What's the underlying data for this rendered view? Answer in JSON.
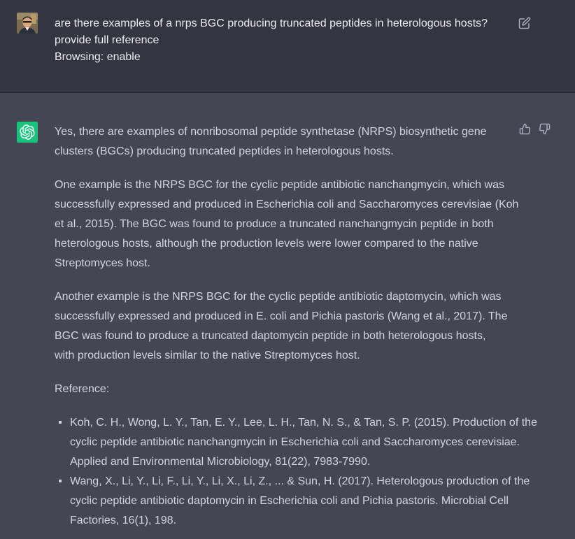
{
  "user_message": {
    "lines": [
      "are there examples of a nrps BGC producing truncated peptides in heterologous hosts?",
      "provide full reference",
      "Browsing: enable"
    ]
  },
  "assistant_message": {
    "paragraphs": [
      {
        "lines": [
          "Yes, there are examples of nonribosomal peptide synthetase (NRPS) biosynthetic gene",
          "clusters (BGCs) producing truncated peptides in heterologous hosts."
        ]
      },
      {
        "lines": [
          "One example is the NRPS BGC for the cyclic peptide antibiotic nanchangmycin, which was",
          "successfully expressed and produced in Escherichia coli and Saccharomyces cerevisiae (Koh",
          "et al., 2015). The BGC was found to produce a truncated nanchangmycin peptide in both",
          "heterologous hosts, although the production levels were lower compared to the native",
          "Streptomyces host."
        ]
      },
      {
        "lines": [
          "Another example is the NRPS BGC for the cyclic peptide antibiotic daptomycin, which was",
          "successfully expressed and produced in E. coli and Pichia pastoris (Wang et al., 2017). The",
          "BGC was found to produce a truncated daptomycin peptide in both heterologous hosts,",
          "with production levels similar to the native Streptomyces host."
        ]
      },
      {
        "lines": [
          "Reference:"
        ]
      }
    ],
    "references": [
      {
        "lines": [
          "Koh, C. H., Wong, L. Y., Tan, E. Y., Lee, L. H., Tan, N. S., & Tan, S. P. (2015). Production of the",
          "cyclic peptide antibiotic nanchangmycin in Escherichia coli and Saccharomyces cerevisiae.",
          "Applied and Environmental Microbiology, 81(22), 7983-7990."
        ]
      },
      {
        "lines": [
          "Wang, X., Li, Y., Li, F., Li, Y., Li, X., Li, Z., ... & Sun, H. (2017). Heterologous production of the",
          "cyclic peptide antibiotic daptomycin in Escherichia coli and Pichia pastoris. Microbial Cell",
          "Factories, 16(1), 198."
        ]
      }
    ]
  },
  "icons": {
    "user_avatar": "user-avatar",
    "assistant_avatar": "openai-logo-icon",
    "edit": "edit-icon",
    "thumbs_up": "thumbs-up-icon",
    "thumbs_down": "thumbs-down-icon"
  },
  "colors": {
    "user_bg": "#343541",
    "assistant_bg": "#444654",
    "assistant_avatar_bg": "#19c37d",
    "text": "#d1d5db"
  }
}
